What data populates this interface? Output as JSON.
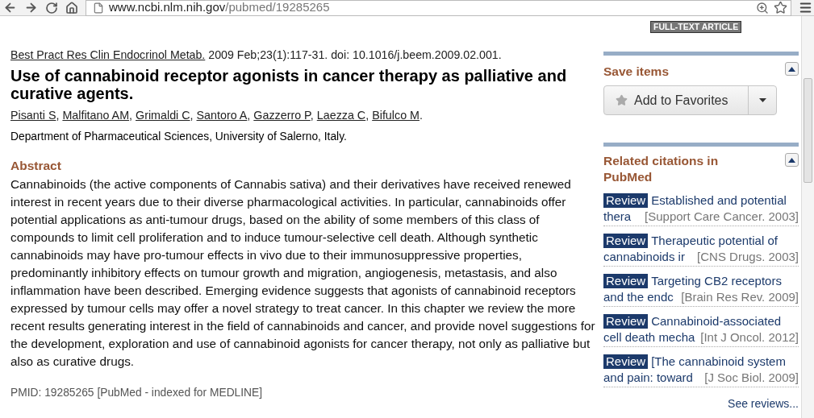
{
  "browser": {
    "url_host": "www.ncbi.nlm.nih.gov",
    "url_path": "/pubmed/19285265"
  },
  "full_text_badge": "FULL-TEXT ARTICLE",
  "citation": {
    "journal": "Best Pract Res Clin Endocrinol Metab.",
    "details": "2009 Feb;23(1):117-31. doi: 10.1016/j.beem.2009.02.001."
  },
  "title": "Use of cannabinoid receptor agonists in cancer therapy as palliative and curative agents.",
  "authors": [
    {
      "name": "Pisanti S",
      "sep": ","
    },
    {
      "name": "Malfitano AM",
      "sep": ","
    },
    {
      "name": "Grimaldi C",
      "sep": ","
    },
    {
      "name": "Santoro A",
      "sep": ","
    },
    {
      "name": "Gazzerro P",
      "sep": ","
    },
    {
      "name": "Laezza C",
      "sep": ","
    },
    {
      "name": "Bifulco M",
      "sep": "."
    }
  ],
  "affiliation": "Department of Pharmaceutical Sciences, University of Salerno, Italy.",
  "abstract": {
    "heading": "Abstract",
    "text": "Cannabinoids (the active components of Cannabis sativa) and their derivatives have received renewed interest in recent years due to their diverse pharmacological activities. In particular, cannabinoids offer potential applications as anti-tumour drugs, based on the ability of some members of this class of compounds to limit cell proliferation and to induce tumour-selective cell death. Although synthetic cannabinoids may have pro-tumour effects in vivo due to their immunosuppressive properties, predominantly inhibitory effects on tumour growth and migration, angiogenesis, metastasis, and also inflammation have been described. Emerging evidence suggests that agonists of cannabinoid receptors expressed by tumour cells may offer a novel strategy to treat cancer. In this chapter we review the more recent results generating interest in the field of cannabinoids and cancer, and provide novel suggestions for the development, exploration and use of cannabinoid agonists for cancer therapy, not only as palliative but also as curative drugs."
  },
  "pmid": "PMID: 19285265 [PubMed - indexed for MEDLINE]",
  "save_items": {
    "heading": "Save items",
    "button": "Add to Favorites"
  },
  "related": {
    "heading": "Related citations in PubMed",
    "items": [
      {
        "badge": "Review",
        "title_line1": "Established and potential",
        "title_line2": "thera",
        "journal": "[Support Care Cancer. 2003]"
      },
      {
        "badge": "Review",
        "title_line1": "Therapeutic potential of",
        "title_line2": "cannabinoids ir",
        "journal": "[CNS Drugs. 2003]"
      },
      {
        "badge": "Review",
        "title_line1": "Targeting CB2 receptors",
        "title_line2": "and the endc",
        "journal": "[Brain Res Rev. 2009]"
      },
      {
        "badge": "Review",
        "title_line1": "Cannabinoid-associated",
        "title_line2": "cell death mecha",
        "journal": "[Int J Oncol. 2012]"
      },
      {
        "badge": "Review",
        "title_line1": "[The cannabinoid system",
        "title_line2": "and pain: toward",
        "journal": "[J Soc Biol. 2009]"
      }
    ],
    "see_more": "See reviews..."
  }
}
